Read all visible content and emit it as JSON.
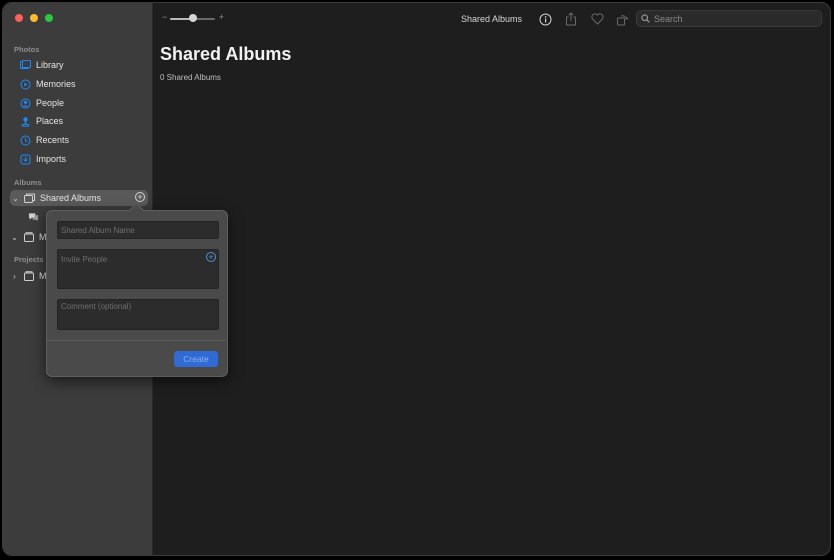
{
  "sidebar": {
    "sections": {
      "photos": "Photos",
      "albums": "Albums",
      "projects": "Projects"
    },
    "photos_items": [
      {
        "label": "Library",
        "icon": "library-icon"
      },
      {
        "label": "Memories",
        "icon": "memories-icon"
      },
      {
        "label": "People",
        "icon": "people-icon"
      },
      {
        "label": "Places",
        "icon": "places-icon"
      },
      {
        "label": "Recents",
        "icon": "recents-icon"
      },
      {
        "label": "Imports",
        "icon": "imports-icon"
      }
    ],
    "albums_items": [
      {
        "label": "Shared Albums",
        "icon": "shared-albums-icon",
        "expanded": true
      },
      {
        "label": "My",
        "icon": "folder-icon",
        "expanded": true
      }
    ],
    "projects_items": [
      {
        "label": "My",
        "icon": "folder-icon",
        "expanded": false
      }
    ]
  },
  "toolbar": {
    "title": "Shared Albums",
    "zoom_minus": "−",
    "zoom_plus": "+",
    "zoom_level": 0.35,
    "search_placeholder": "Search"
  },
  "main": {
    "title": "Shared Albums",
    "subtitle": "0 Shared Albums"
  },
  "popover": {
    "album_name_placeholder": "Shared Album Name",
    "invite_placeholder": "Invite People",
    "comment_placeholder": "Comment (optional)",
    "create_label": "Create"
  },
  "colors": {
    "accent": "#1a8cff",
    "create_button": "#2f6ad6",
    "sidebar_bg": "#3c3c3c",
    "content_bg": "#1e1e1e"
  }
}
